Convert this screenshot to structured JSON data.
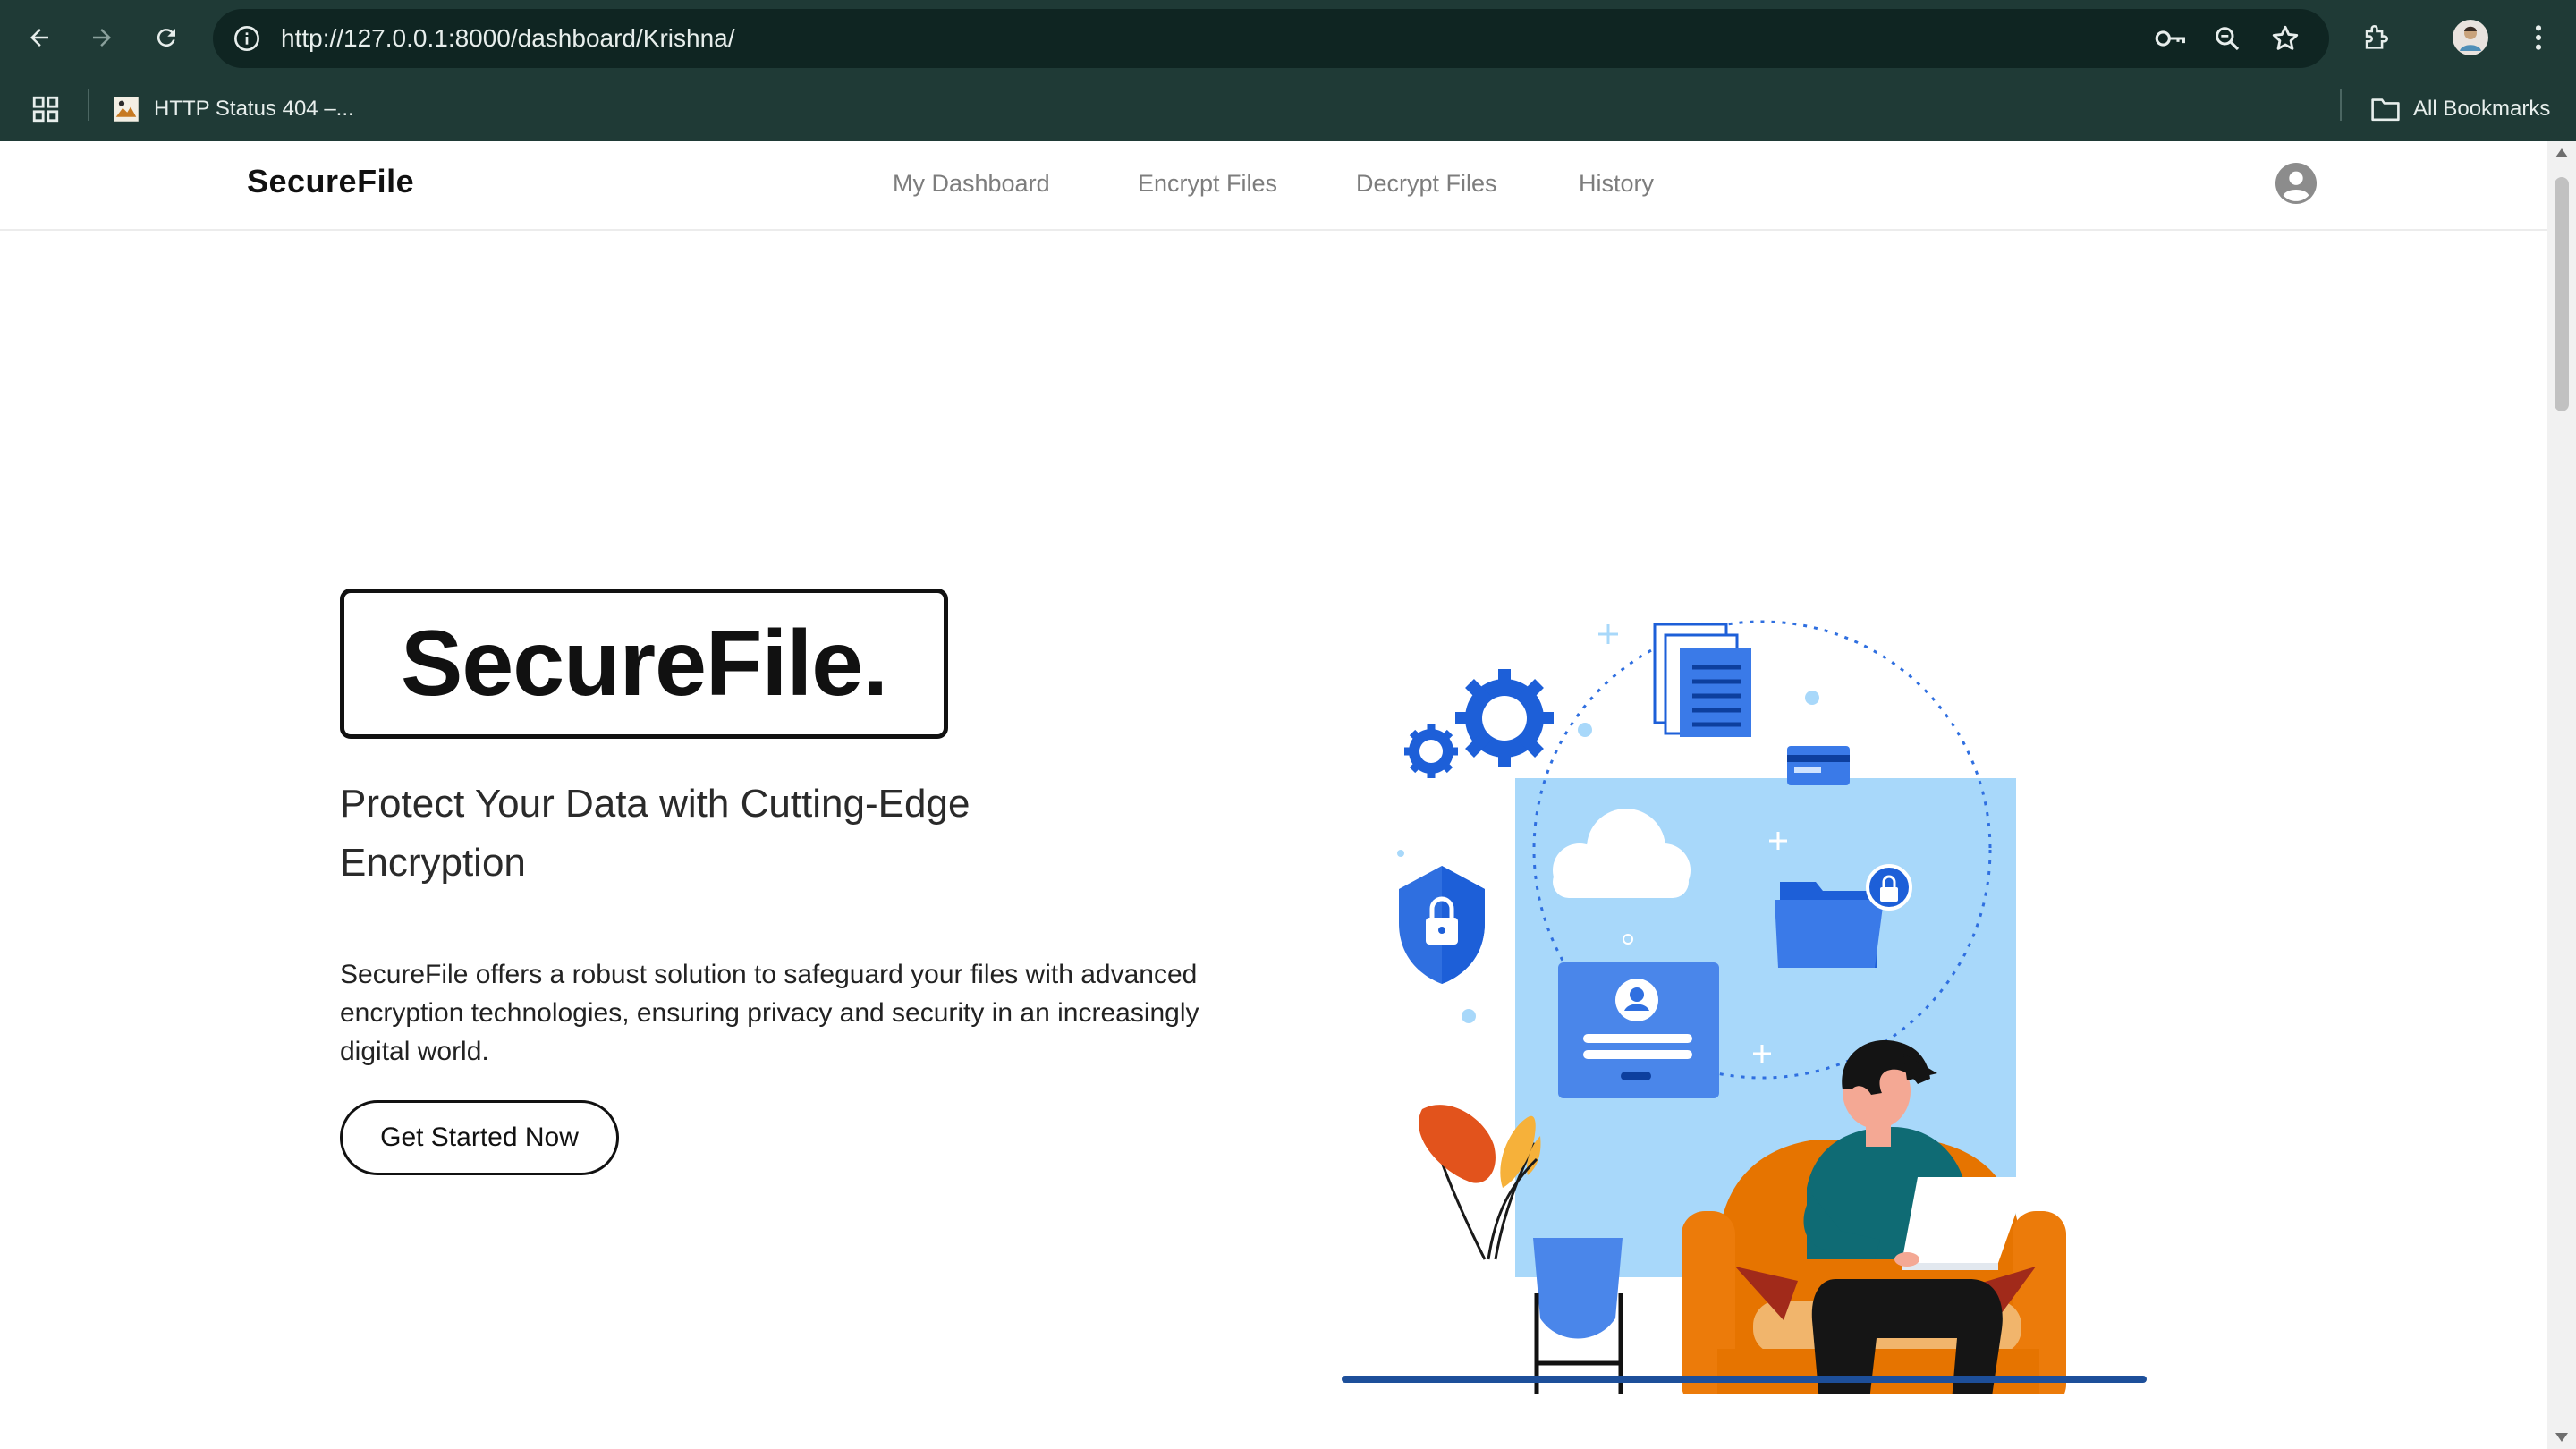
{
  "browser": {
    "url": "http://127.0.0.1:8000/dashboard/Krishna/",
    "bookmarks": [
      {
        "label": "HTTP Status 404 –..."
      }
    ],
    "all_bookmarks_label": "All Bookmarks"
  },
  "nav": {
    "brand": "SecureFile",
    "links": [
      "My Dashboard",
      "Encrypt Files",
      "Decrypt Files",
      "History"
    ]
  },
  "hero": {
    "title": "SecureFile.",
    "subtitle": "Protect Your Data with Cutting-Edge Encryption",
    "description": "SecureFile offers a robust solution to safeguard your files with advanced encryption technologies, ensuring privacy and security in an increasingly digital world.",
    "cta_label": "Get Started Now"
  },
  "colors": {
    "chrome_bg": "#1f3a36",
    "omnibox_bg": "#0f2522",
    "accent_blue": "#2f6fe0",
    "light_blue": "#a8d8fa",
    "sofa_orange": "#ec7b0a"
  },
  "icons": [
    "back-icon",
    "forward-icon",
    "reload-icon",
    "site-info-icon",
    "password-key-icon",
    "zoom-icon",
    "star-icon",
    "extensions-icon",
    "profile-avatar-icon",
    "menu-icon",
    "apps-grid-icon",
    "bookmark-favicon",
    "folder-icon",
    "user-account-icon"
  ]
}
